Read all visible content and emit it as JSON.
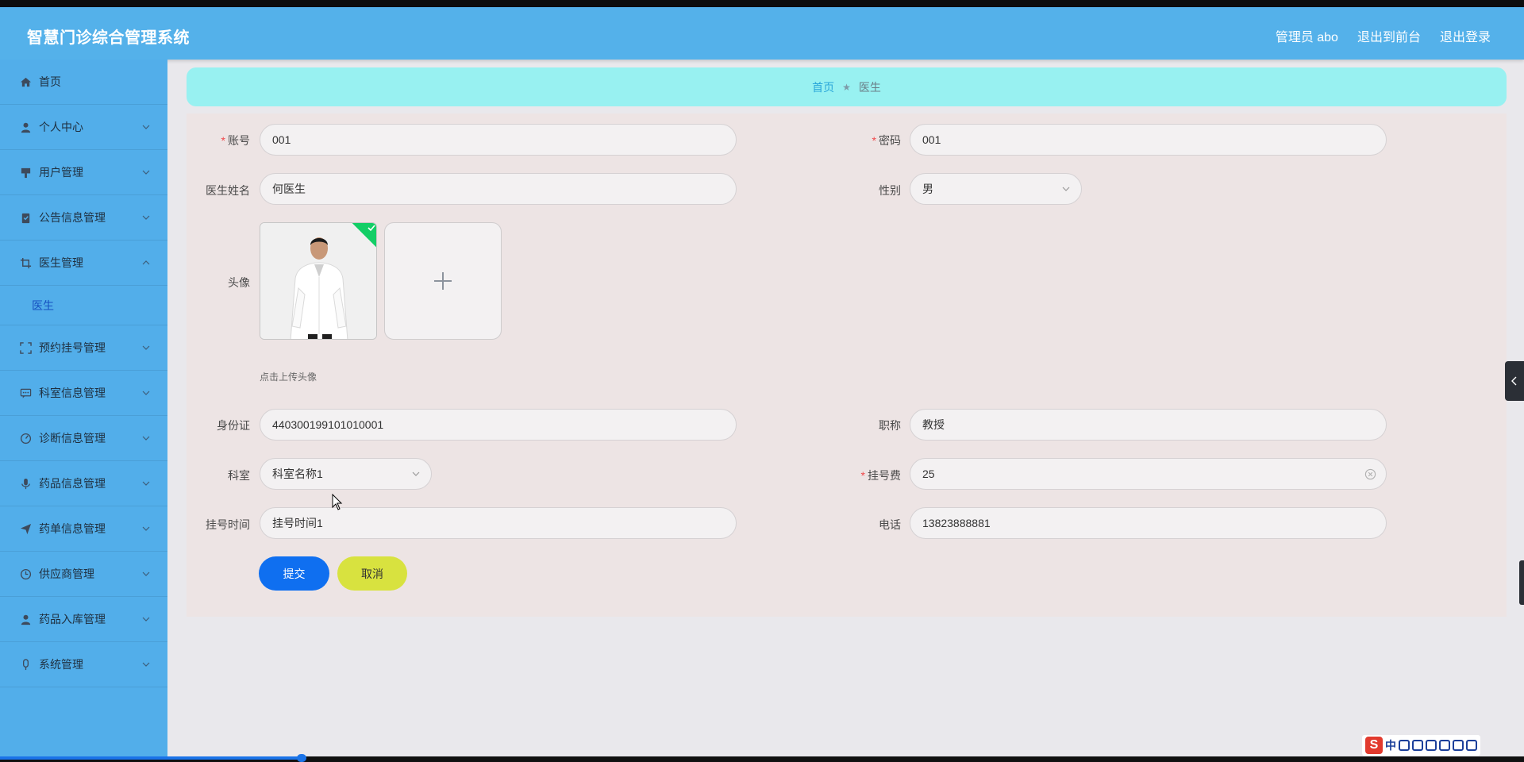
{
  "header": {
    "title": "智慧门诊综合管理系统",
    "links": [
      "管理员 abo",
      "退出到前台",
      "退出登录"
    ]
  },
  "sidebar": {
    "items": [
      {
        "label": "首页",
        "icon": "home-icon"
      },
      {
        "label": "个人中心",
        "icon": "user-icon"
      },
      {
        "label": "用户管理",
        "icon": "brush-icon"
      },
      {
        "label": "公告信息管理",
        "icon": "clipboard-icon"
      },
      {
        "label": "医生管理",
        "icon": "crop-icon",
        "expanded": true,
        "children": [
          "医生"
        ]
      },
      {
        "label": "预约挂号管理",
        "icon": "fullscreen-icon"
      },
      {
        "label": "科室信息管理",
        "icon": "chat-icon"
      },
      {
        "label": "诊断信息管理",
        "icon": "compass-icon"
      },
      {
        "label": "药品信息管理",
        "icon": "microphone-icon"
      },
      {
        "label": "药单信息管理",
        "icon": "send-icon"
      },
      {
        "label": "供应商管理",
        "icon": "clock-icon"
      },
      {
        "label": "药品入库管理",
        "icon": "user-icon"
      },
      {
        "label": "系统管理",
        "icon": "mic-icon"
      }
    ]
  },
  "breadcrumb": {
    "home": "首页",
    "separator": "★",
    "current": "医生"
  },
  "form": {
    "account": {
      "label": "账号",
      "value": "001",
      "required": true
    },
    "password": {
      "label": "密码",
      "value": "001",
      "required": true
    },
    "doctor_name": {
      "label": "医生姓名",
      "value": "何医生"
    },
    "gender": {
      "label": "性别",
      "value": "男"
    },
    "avatar": {
      "label": "头像",
      "hint": "点击上传头像"
    },
    "id_card": {
      "label": "身份证",
      "value": "440300199101010001"
    },
    "title": {
      "label": "职称",
      "value": "教授"
    },
    "department": {
      "label": "科室",
      "value": "科室名称1"
    },
    "fee": {
      "label": "挂号费",
      "value": "25",
      "required": true
    },
    "reg_time": {
      "label": "挂号时间",
      "value": "挂号时间1"
    },
    "phone": {
      "label": "电话",
      "value": "13823888881"
    },
    "submit_label": "提交",
    "cancel_label": "取消"
  },
  "ime": {
    "logo": "S",
    "lang": "中"
  },
  "colors": {
    "header": "#54b1ea",
    "sidebar": "#52aeea",
    "breadcrumb_bg": "#98f1f1",
    "panel": "#ede4e4",
    "submit": "#0f6ff0",
    "cancel": "#d8e23f"
  }
}
